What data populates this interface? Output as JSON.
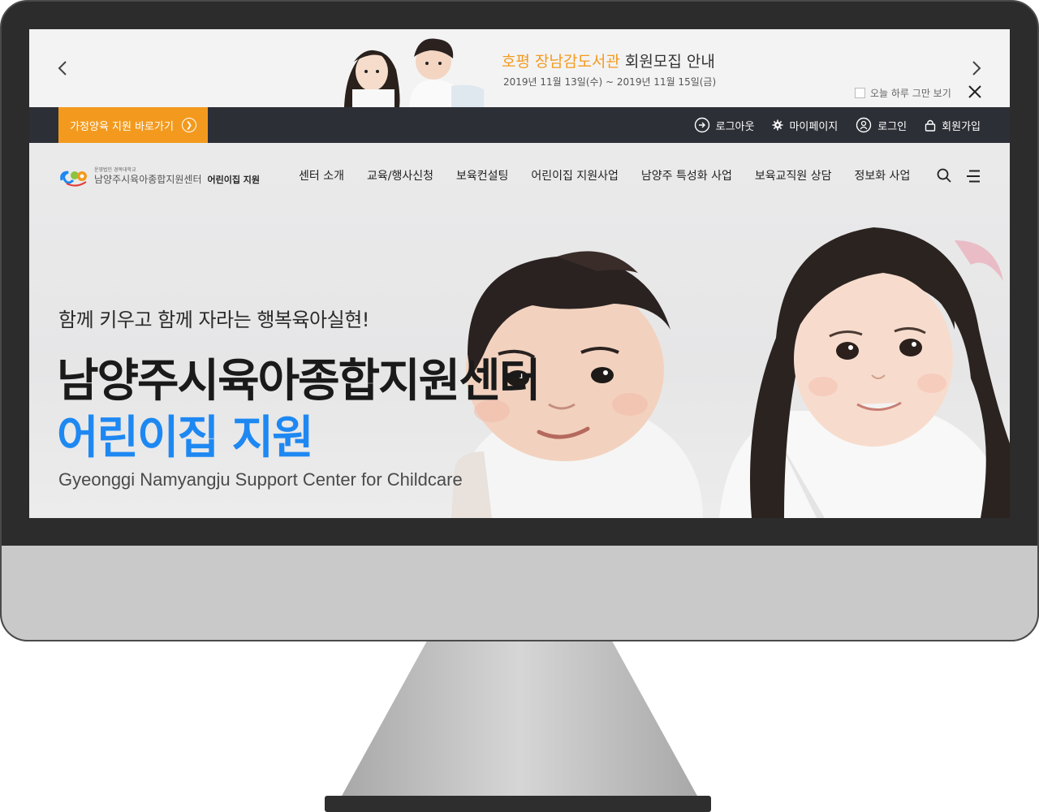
{
  "banner": {
    "title_highlight": "호평 장남감도서관",
    "title_rest": " 회원모집 안내",
    "date": "2019년 11월 13일(수) ~ 2019년 11월 15일(금)",
    "dont_show_label": "오늘 하루 그만 보기"
  },
  "utility": {
    "quick_label": "가정양육 지원 바로가기",
    "links": [
      {
        "label": "로그아웃",
        "icon": "logout-icon"
      },
      {
        "label": "마이페이지",
        "icon": "gear-icon"
      },
      {
        "label": "로그인",
        "icon": "user-icon"
      },
      {
        "label": "회원가입",
        "icon": "lock-icon"
      }
    ]
  },
  "header": {
    "logo_small": "운영법인 경복대학교",
    "logo_name": "남양주시육아종합지원센터",
    "logo_sub": "어린이집 지원",
    "menu": [
      "센터 소개",
      "교육/행사신청",
      "보육컨설팅",
      "어린이집 지원사업",
      "남양주 특성화 사업",
      "보육교직원 상담",
      "정보화 사업"
    ]
  },
  "hero": {
    "slogan": "함께 키우고 함께 자라는 행복육아실현!",
    "title": "남양주시육아종합지원센터",
    "subtitle": "어린이집 지원",
    "english": "Gyeonggi Namyangju Support Center for Childcare"
  },
  "colors": {
    "accent_orange": "#f39a1e",
    "accent_blue": "#1e88f2",
    "utility_bar": "#2d2f36"
  }
}
